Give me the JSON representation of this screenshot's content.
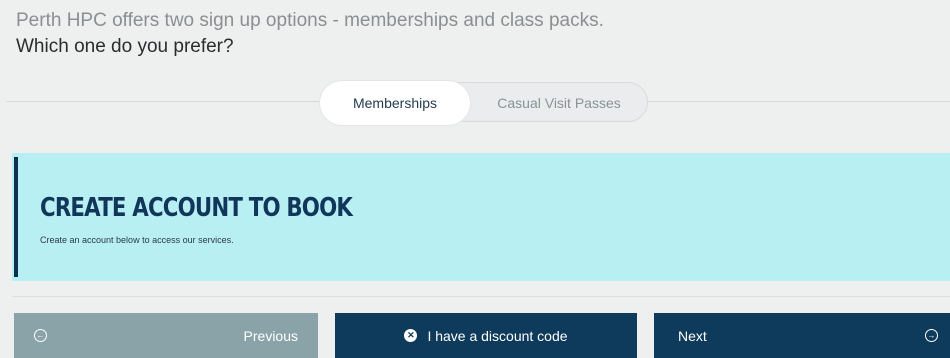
{
  "intro": {
    "line1": "Perth HPC offers two sign up options - memberships and class packs.",
    "line2": "Which one do you prefer?"
  },
  "toggle": {
    "active_label": "Memberships",
    "inactive_label": "Casual Visit Passes"
  },
  "banner": {
    "title": "CREATE ACCOUNT TO BOOK",
    "subtitle": "Create an account below to access our services."
  },
  "buttons": {
    "previous_label": "Previous",
    "discount_label": "I have a discount code",
    "next_label": "Next"
  },
  "icons": {
    "previous": "arrow-left-circle-icon",
    "discount": "x-circle-icon",
    "next": "arrow-right-circle-icon"
  },
  "colors": {
    "navy": "#0e3a5b",
    "banner_bg": "#b7eff3",
    "previous_bg": "#8aa3a8",
    "page_bg": "#eeefef"
  }
}
